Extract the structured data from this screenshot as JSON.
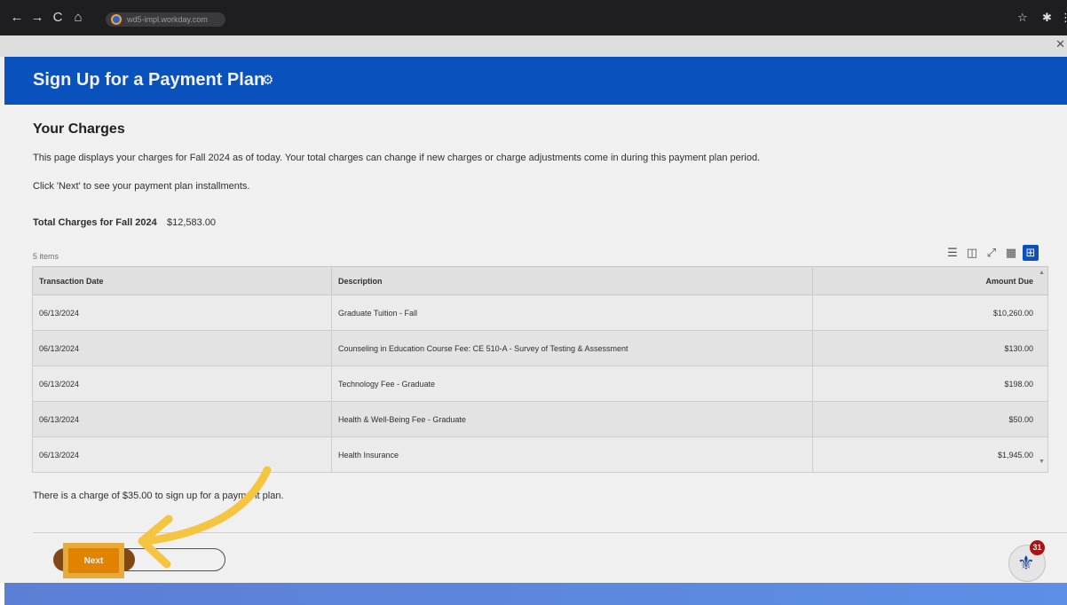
{
  "browser": {
    "url": "wd5-impl.workday.com",
    "nav": {
      "back": "←",
      "forward": "→",
      "reload": "C",
      "home": "⌂"
    }
  },
  "banner": {
    "title": "Sign Up for a Payment Plan"
  },
  "charges": {
    "heading": "Your Charges",
    "intro": "This page displays your charges for Fall 2024 as of today. Your total charges can change if new charges or charge adjustments come in during this payment plan period.",
    "hint": "Click 'Next' to see your payment plan installments.",
    "total_label": "Total Charges for Fall 2024",
    "total_value": "$12,583.00",
    "items_count": "5 items"
  },
  "table": {
    "headers": [
      "Transaction Date",
      "Description",
      "Amount Due"
    ],
    "rows": [
      {
        "date": "06/13/2024",
        "description": "Graduate Tuition - Fall",
        "amount": "$10,260.00"
      },
      {
        "date": "06/13/2024",
        "description": "Counseling in Education Course Fee: CE 510-A - Survey of Testing & Assessment",
        "amount": "$130.00"
      },
      {
        "date": "06/13/2024",
        "description": "Technology Fee - Graduate",
        "amount": "$198.00"
      },
      {
        "date": "06/13/2024",
        "description": "Health & Well-Being Fee - Graduate",
        "amount": "$50.00"
      },
      {
        "date": "06/13/2024",
        "description": "Health Insurance",
        "amount": "$1,945.00"
      }
    ]
  },
  "note": "There is a charge of $35.00 to sign up for a payment plan.",
  "buttons": {
    "next": "Next"
  },
  "assistant": {
    "badge": "31"
  },
  "colors": {
    "banner": "#0a58c9",
    "next_button": "#f08c00",
    "highlight": "#f5b63f",
    "arrow": "#f5c542"
  }
}
